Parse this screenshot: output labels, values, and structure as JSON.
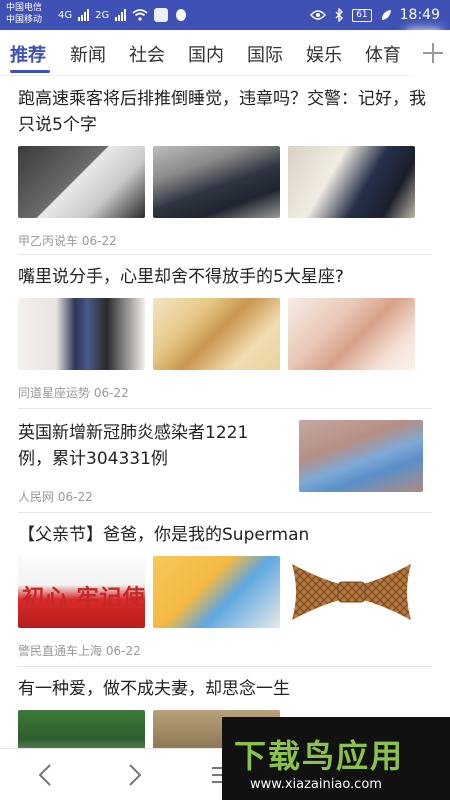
{
  "status_bar": {
    "carrier_1": "中国电信",
    "carrier_2": "中国移动",
    "net_1": "4G",
    "net_2": "2G",
    "battery": "61",
    "time": "18:49"
  },
  "tabs": [
    "推荐",
    "新闻",
    "社会",
    "国内",
    "国际",
    "娱乐",
    "体育"
  ],
  "articles": [
    {
      "title": "跑高速乘客将后排推倒睡觉，违章吗？交警：记好，我只说5个字",
      "source": "甲乙丙说车",
      "date": "06-22"
    },
    {
      "title": "嘴里说分手，心里却舍不得放手的5大星座?",
      "source": "同道星座运势",
      "date": "06-22"
    },
    {
      "title": "英国新增新冠肺炎感染者1221例，累计304331例",
      "source": "人民网",
      "date": "06-22"
    },
    {
      "title": "【父亲节】爸爸，你是我的Superman",
      "source": "警民直通车上海",
      "date": "06-22",
      "image_text": "初心 牢记使"
    },
    {
      "title": "有一种爱，做不成夫妻，却思念一生"
    }
  ],
  "watermark": {
    "brand": "下载鸟应用",
    "url": "www.xiazainiao.com"
  },
  "colors": {
    "primary": "#3f51b5",
    "watermark_green": "#8bc34a"
  },
  "icons": [
    "back-icon",
    "forward-icon",
    "menu-icon",
    "add-icon"
  ]
}
